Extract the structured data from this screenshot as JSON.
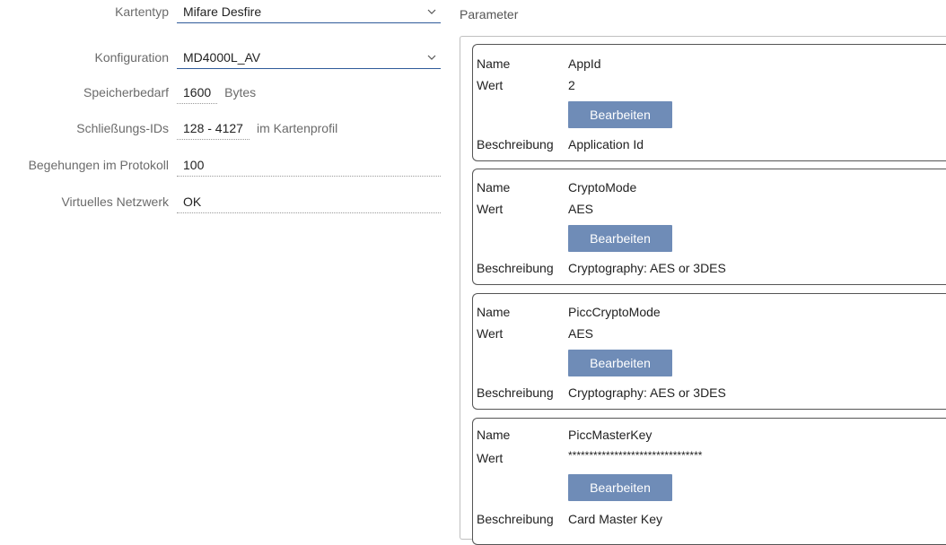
{
  "form": {
    "card_type": {
      "label": "Kartentyp",
      "value": "Mifare Desfire"
    },
    "configuration": {
      "label": "Konfiguration",
      "value": "MD4000L_AV"
    },
    "memory": {
      "label": "Speicherbedarf",
      "value": "1600",
      "unit": "Bytes"
    },
    "locking_ids": {
      "label": "Schließungs-IDs",
      "value": "128 - 4127",
      "unit": "im Kartenprofil"
    },
    "protocol": {
      "label": "Begehungen im Protokoll",
      "value": "100"
    },
    "network": {
      "label": "Virtuelles Netzwerk",
      "value": "OK"
    }
  },
  "parameters": {
    "title": "Parameter",
    "name_label": "Name",
    "value_label": "Wert",
    "desc_label": "Beschreibung",
    "edit_label": "Bearbeiten",
    "items": [
      {
        "name": "AppId",
        "value": "2",
        "description": "Application Id"
      },
      {
        "name": "CryptoMode",
        "value": "AES",
        "description": "Cryptography: AES or 3DES"
      },
      {
        "name": "PiccCryptoMode",
        "value": "AES",
        "description": "Cryptography: AES or 3DES"
      },
      {
        "name": "PiccMasterKey",
        "value": "********************************",
        "description": "Card Master Key"
      }
    ]
  },
  "colors": {
    "accent": "#2f5b9a",
    "button": "#6f8cb7"
  }
}
